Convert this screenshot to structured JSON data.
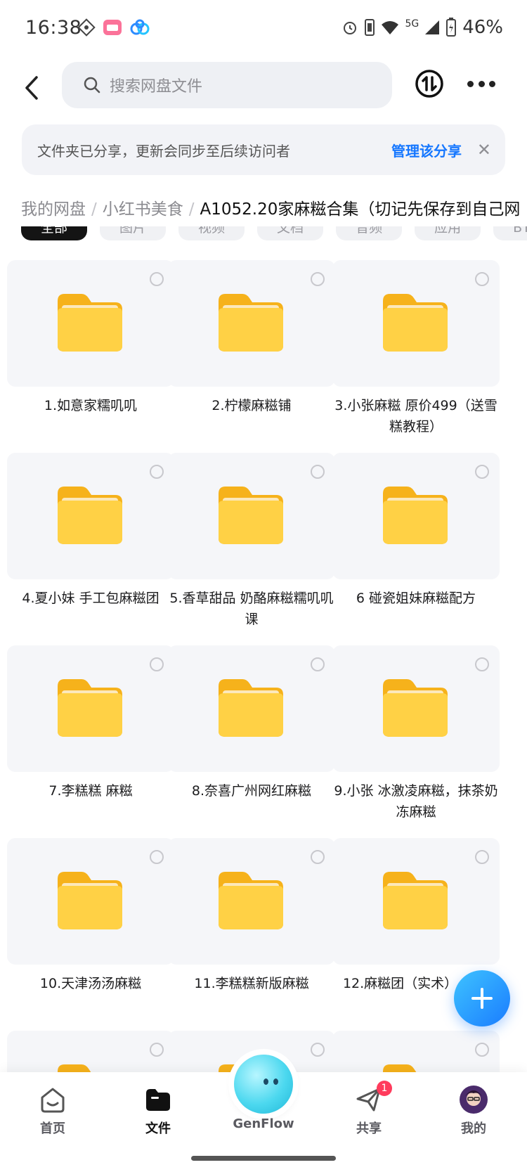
{
  "status_bar": {
    "time": "16:38",
    "network": "5G",
    "battery": "46%"
  },
  "search": {
    "placeholder": "搜索网盘文件"
  },
  "banner": {
    "text": "文件夹已分享，更新会同步至后续访问者",
    "action": "管理该分享"
  },
  "breadcrumb": {
    "items": [
      "我的网盘",
      "小红书美食"
    ],
    "current": "A1052.20家麻糍合集（切记先保存到自己网"
  },
  "filters": [
    "全部",
    "图片",
    "视频",
    "文档",
    "音频",
    "应用",
    "BT种子"
  ],
  "folders": [
    "1.如意家糯叽叽",
    "2.柠檬麻糍铺",
    "3.小张麻糍 原价499（送雪糕教程）",
    "4.夏小妹 手工包麻糍团",
    "5.香草甜品 奶酪麻糍糯叽叽课",
    "6 碰瓷姐妹麻糍配方",
    "7.李糕糕 麻糍",
    "8.奈喜广州网红麻糍",
    "9.小张 冰激凌麻糍，抹茶奶冻麻糍",
    "10.天津汤汤麻糍",
    "11.李糕糕新版麻糍",
    "12.麻糍团（实术）-阿明",
    "",
    "",
    ""
  ],
  "nav": {
    "home": "首页",
    "files": "文件",
    "genflow": "GenFlow",
    "share": "共享",
    "share_badge": "1",
    "mine": "我的"
  },
  "colors": {
    "accent": "#1677ff",
    "folder": "#ffcc33",
    "badge": "#ff3b5c"
  }
}
